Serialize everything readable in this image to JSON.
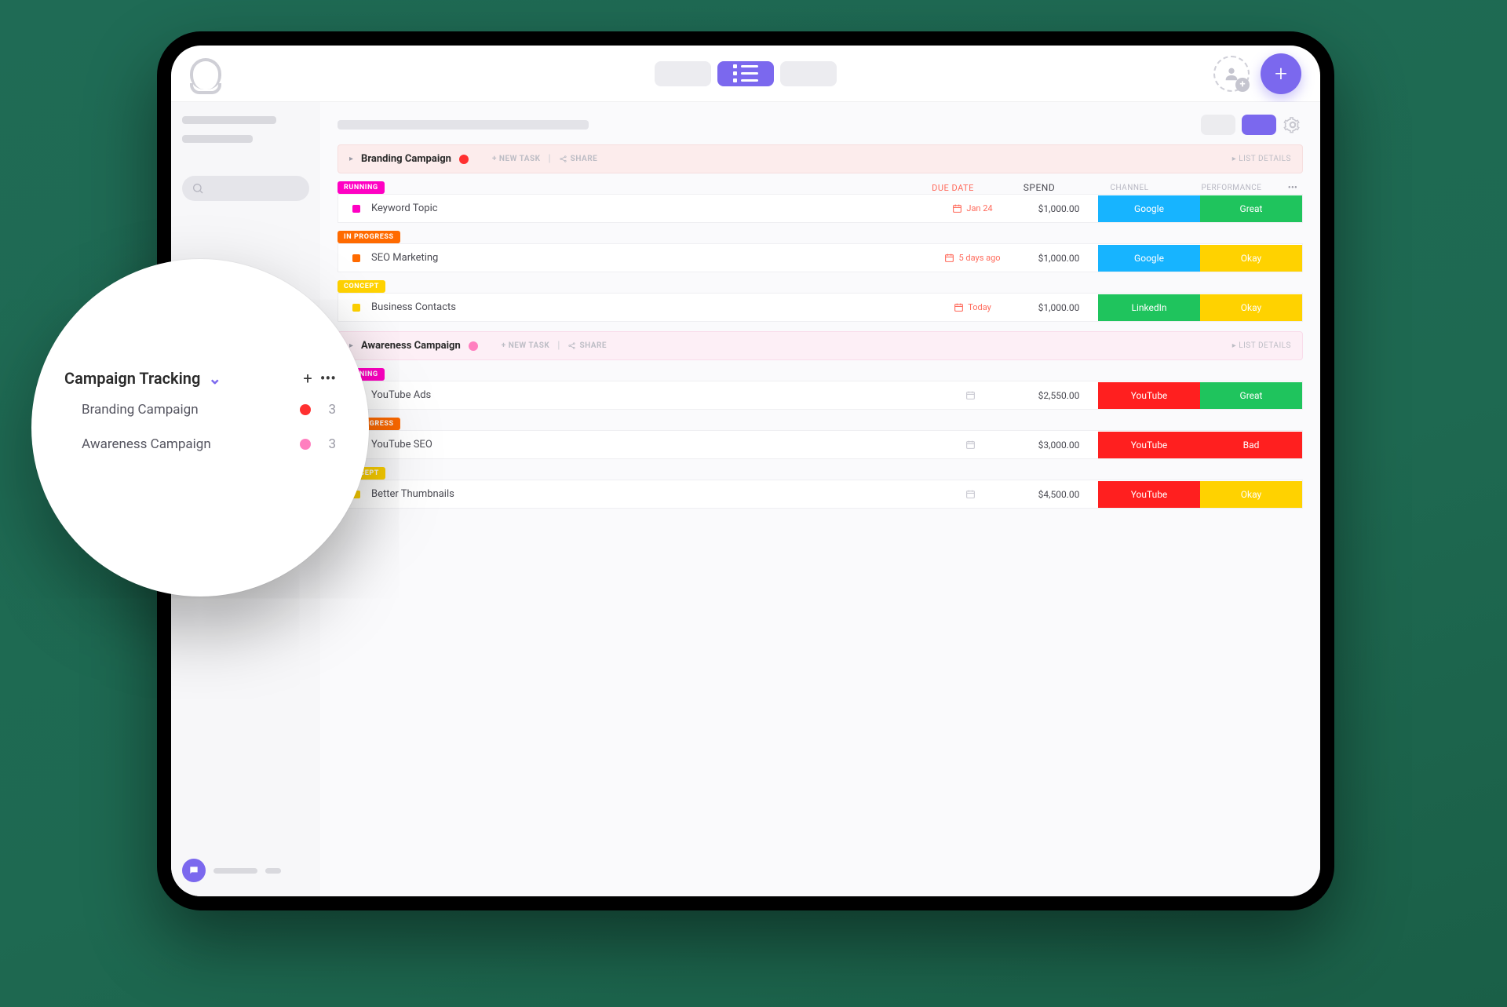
{
  "header": {
    "new_task": "+ NEW TASK",
    "share": "SHARE",
    "list_details": "LIST DETAILS"
  },
  "columns": {
    "due": "DUE DATE",
    "spend": "SPEND",
    "channel": "CHANNEL",
    "performance": "PERFORMANCE"
  },
  "status": {
    "running": "RUNNING",
    "in_progress": "IN PROGRESS",
    "concept": "CONCEPT"
  },
  "groups": [
    {
      "title": "Branding Campaign",
      "dot": "red",
      "tasks": [
        {
          "status": "running",
          "name": "Keyword Topic",
          "due": "Jan 24",
          "spend": "$1,000.00",
          "channel": "Google",
          "perf": "Great"
        },
        {
          "status": "in_progress",
          "name": "SEO Marketing",
          "due": "5 days ago",
          "spend": "$1,000.00",
          "channel": "Google",
          "perf": "Okay"
        },
        {
          "status": "concept",
          "name": "Business Contacts",
          "due": "Today",
          "spend": "$1,000.00",
          "channel": "LinkedIn",
          "perf": "Okay"
        }
      ]
    },
    {
      "title": "Awareness Campaign",
      "dot": "pink",
      "tasks": [
        {
          "status": "running",
          "name": "YouTube Ads",
          "due": "",
          "spend": "$2,550.00",
          "channel": "YouTube",
          "perf": "Great"
        },
        {
          "status": "in_progress",
          "name": "YouTube SEO",
          "due": "",
          "spend": "$3,000.00",
          "channel": "YouTube",
          "perf": "Bad"
        },
        {
          "status": "concept",
          "name": "Better Thumbnails",
          "due": "",
          "spend": "$4,500.00",
          "channel": "YouTube",
          "perf": "Okay"
        }
      ]
    }
  ],
  "bubble": {
    "title": "Campaign Tracking",
    "items": [
      {
        "name": "Branding Campaign",
        "dot": "red",
        "count": "3"
      },
      {
        "name": "Awareness Campaign",
        "dot": "pink",
        "count": "3"
      }
    ]
  },
  "channel_class": {
    "Google": "google",
    "LinkedIn": "linkedin",
    "YouTube": "youtube"
  },
  "perf_class": {
    "Great": "great",
    "Okay": "okay",
    "Bad": "bad"
  },
  "status_class": {
    "running": "mag",
    "in_progress": "org",
    "concept": "yel"
  },
  "status_tag_class": {
    "running": "st-running",
    "in_progress": "st-progress",
    "concept": "st-concept"
  }
}
